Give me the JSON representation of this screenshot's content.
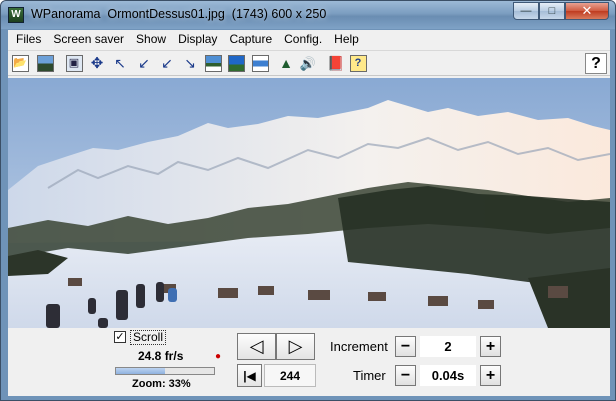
{
  "window": {
    "title": "WPanorama  OrmontDessus01.jpg  (1743) 600 x 250",
    "app_icon_letter": "W",
    "minimize_glyph": "—",
    "maximize_glyph": "□",
    "close_glyph": "✕"
  },
  "menu": [
    "Files",
    "Screen saver",
    "Show",
    "Display",
    "Capture",
    "Config.",
    "Help"
  ],
  "toolbar": {
    "icons": [
      "open-icon",
      "picture-icon",
      "frame-icon",
      "move-icon",
      "top-left-arrow-icon",
      "bottom-left-arrow-icon",
      "left-arrow-icon",
      "bottom-right-arrow-icon",
      "image-band-icon",
      "image-wide-icon",
      "image-thin-icon",
      "mountain-icon",
      "speaker-icon",
      "book-icon",
      "help-page-icon"
    ],
    "help_label": "?"
  },
  "controls": {
    "scroll_label": "Scroll",
    "scroll_checked": "✓",
    "fps": "24.8 fr/s",
    "zoom_label": "Zoom: 33%",
    "zoom_percent": 33,
    "prev_glyph": "◁",
    "next_glyph": "▷",
    "goto_start_glyph": "|◀",
    "position": "244",
    "increment_label": "Increment",
    "increment_value": "2",
    "timer_label": "Timer",
    "timer_value": "0.04s",
    "minus": "−",
    "plus": "+"
  },
  "colors": {
    "sky": "#9fb9d8",
    "snow": "#f3f5fa",
    "forest": "#2a3327"
  }
}
